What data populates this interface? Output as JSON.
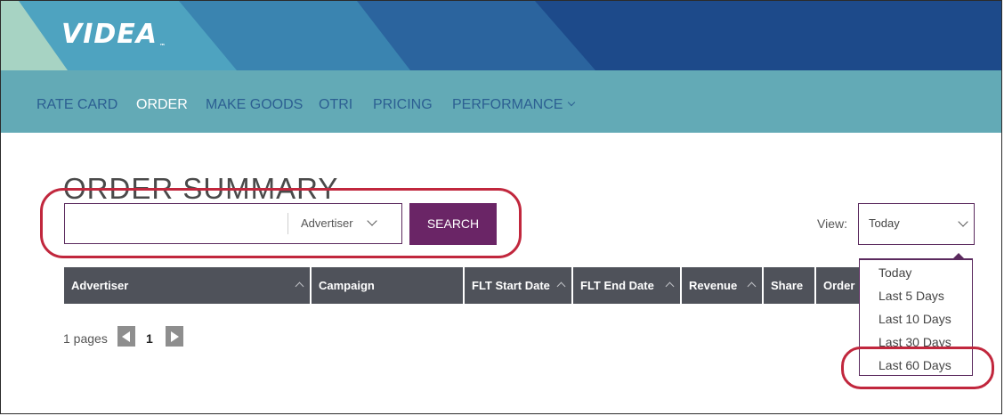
{
  "brand": {
    "logo_text": "VIDEA",
    "trademark": "™"
  },
  "nav": {
    "items": [
      {
        "label": "RATE CARD"
      },
      {
        "label": "ORDER"
      },
      {
        "label": "MAKE GOODS"
      },
      {
        "label": "OTRI"
      },
      {
        "label": "PRICING"
      },
      {
        "label": "PERFORMANCE"
      }
    ],
    "active": "ORDER"
  },
  "page": {
    "title": "ORDER SUMMARY"
  },
  "search": {
    "input_value": "",
    "type_selected": "Advertiser",
    "button_label": "SEARCH"
  },
  "view": {
    "label": "View:",
    "selected": "Today",
    "options": [
      "Today",
      "Last 5 Days",
      "Last 10 Days",
      "Last 30 Days",
      "Last 60 Days"
    ],
    "highlighted_option": "Last 60 Days"
  },
  "table": {
    "columns": [
      "Advertiser",
      "Campaign",
      "FLT Start Date",
      "FLT End Date",
      "Revenue",
      "Share",
      "Order #"
    ]
  },
  "pagination": {
    "label": "1 pages",
    "current_page": "1"
  },
  "colors": {
    "nav_bg": "#63aab6",
    "nav_text": "#2c5f92",
    "accent_purple": "#6a2566",
    "table_header": "#4f525a",
    "annotation_red": "#c1273d"
  }
}
